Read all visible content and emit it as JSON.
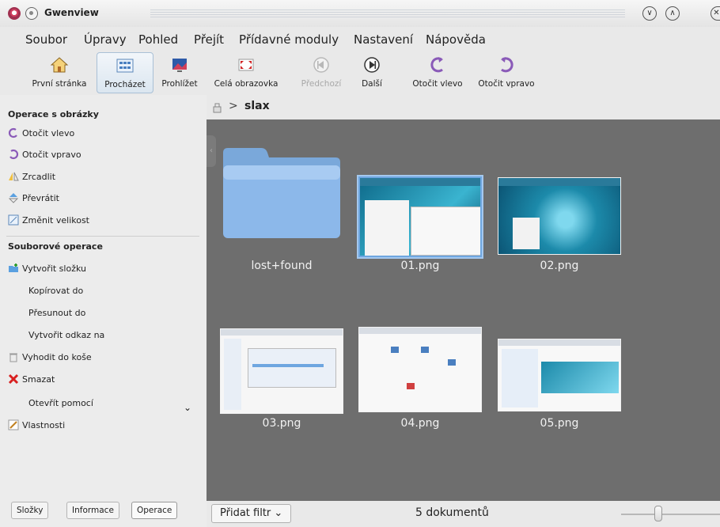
{
  "window": {
    "title": "Gwenview"
  },
  "menu": [
    "Soubor",
    "Úpravy",
    "Pohled",
    "Přejít",
    "Přídavné moduly",
    "Nastavení",
    "Nápověda"
  ],
  "toolbar": [
    {
      "label": "První stránka",
      "icon": "home-icon",
      "state": "normal"
    },
    {
      "label": "Procházet",
      "icon": "browse-icon",
      "state": "active"
    },
    {
      "label": "Prohlížet",
      "icon": "view-icon",
      "state": "normal"
    },
    {
      "label": "Celá obrazovka",
      "icon": "fullscreen-icon",
      "state": "normal"
    },
    {
      "label": "Předchozí",
      "icon": "previous-icon",
      "state": "disabled"
    },
    {
      "label": "Další",
      "icon": "next-icon",
      "state": "normal"
    },
    {
      "label": "Otočit vlevo",
      "icon": "rotate-left-icon",
      "state": "normal"
    },
    {
      "label": "Otočit vpravo",
      "icon": "rotate-right-icon",
      "state": "normal"
    }
  ],
  "sidebar": {
    "image_ops_title": "Operace s obrázky",
    "image_ops": [
      {
        "label": "Otočit vlevo",
        "icon": "rotate-left-icon"
      },
      {
        "label": "Otočit vpravo",
        "icon": "rotate-right-icon"
      },
      {
        "label": "Zrcadlit",
        "icon": "mirror-icon"
      },
      {
        "label": "Převrátit",
        "icon": "flip-icon"
      },
      {
        "label": "Změnit velikost",
        "icon": "resize-icon"
      }
    ],
    "file_ops_title": "Souborové operace",
    "file_ops": [
      {
        "label": "Vytvořit složku",
        "icon": "new-folder-icon"
      },
      {
        "label": "Kopírovat do",
        "icon": ""
      },
      {
        "label": "Přesunout do",
        "icon": ""
      },
      {
        "label": "Vytvořit odkaz na",
        "icon": ""
      },
      {
        "label": "Vyhodit do koše",
        "icon": "trash-icon"
      },
      {
        "label": "Smazat",
        "icon": "delete-icon"
      },
      {
        "label": "Otevřít pomocí",
        "icon": ""
      },
      {
        "label": "Vlastnosti",
        "icon": "properties-icon"
      }
    ],
    "tabs": [
      "Složky",
      "Informace",
      "Operace"
    ],
    "active_tab": "Operace"
  },
  "breadcrumb": {
    "path": "slax",
    "separator": ">"
  },
  "items": [
    {
      "name": "lost+found",
      "type": "folder"
    },
    {
      "name": "01.png",
      "type": "image",
      "selected": true
    },
    {
      "name": "02.png",
      "type": "image"
    },
    {
      "name": "03.png",
      "type": "image"
    },
    {
      "name": "04.png",
      "type": "image"
    },
    {
      "name": "05.png",
      "type": "image"
    }
  ],
  "statusbar": {
    "filter_label": "Přidat filtr",
    "count_label": "5 dokumentů"
  },
  "colors": {
    "view_bg": "#6e6e6e",
    "selection": "#6ea6e0",
    "folder": "#8cb8ea"
  }
}
